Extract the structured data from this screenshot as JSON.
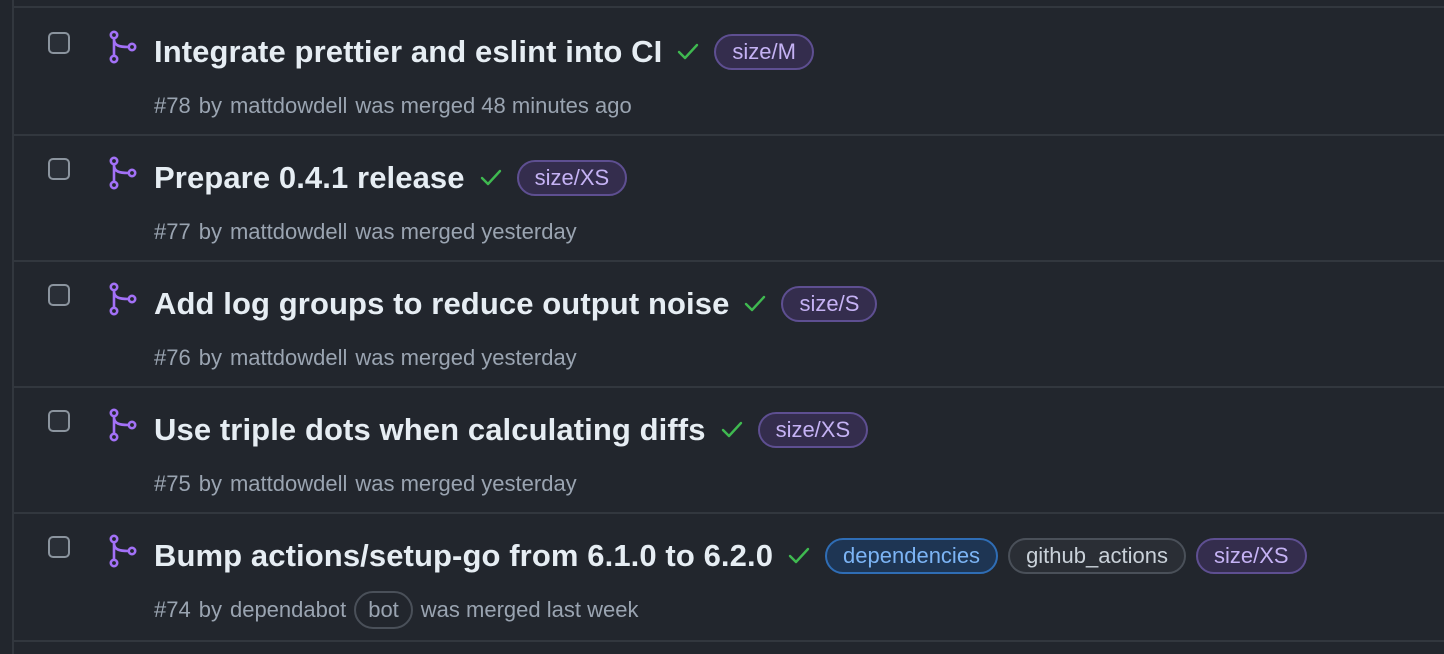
{
  "colors": {
    "background": "#22262d",
    "merged_icon": "#a371f7",
    "check": "#3fb950",
    "label_size_bg": "#342d4d",
    "label_dependencies_bg": "#1e3553"
  },
  "pull_requests": [
    {
      "title": "Integrate prettier and eslint into CI",
      "labels": [
        "size/M"
      ],
      "number": "#78",
      "by": "by",
      "author": "mattdowdell",
      "status": "was merged 48 minutes ago"
    },
    {
      "title": "Prepare 0.4.1 release",
      "labels": [
        "size/XS"
      ],
      "number": "#77",
      "by": "by",
      "author": "mattdowdell",
      "status": "was merged yesterday"
    },
    {
      "title": "Add log groups to reduce output noise",
      "labels": [
        "size/S"
      ],
      "number": "#76",
      "by": "by",
      "author": "mattdowdell",
      "status": "was merged yesterday"
    },
    {
      "title": "Use triple dots when calculating diffs",
      "labels": [
        "size/XS"
      ],
      "number": "#75",
      "by": "by",
      "author": "mattdowdell",
      "status": "was merged yesterday"
    },
    {
      "title": "Bump actions/setup-go from 6.1.0 to 6.2.0",
      "labels": [
        "dependencies",
        "github_actions",
        "size/XS"
      ],
      "number": "#74",
      "by": "by",
      "author": "dependabot",
      "author_badge": "bot",
      "status": "was merged last week"
    }
  ],
  "icons": {
    "row_icon": "git-merge-icon",
    "status_icon": "check-icon",
    "select": "checkbox"
  }
}
